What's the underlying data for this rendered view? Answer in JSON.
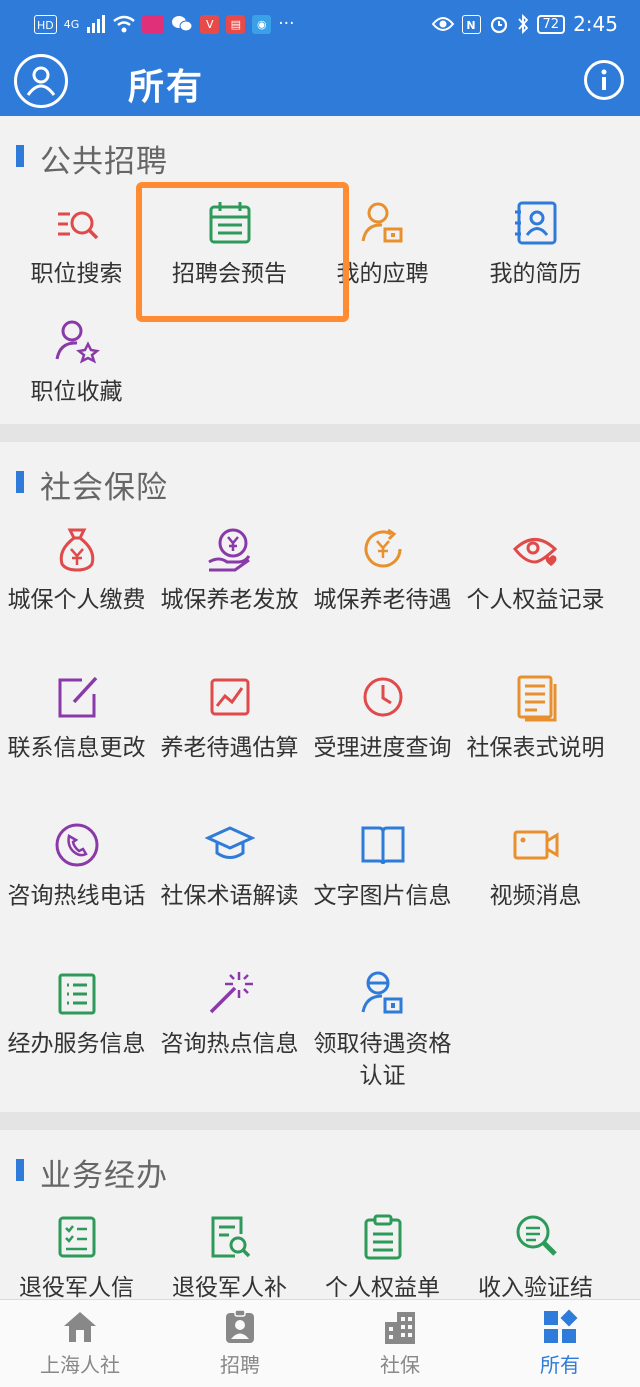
{
  "status_bar": {
    "net": "HD",
    "signal": "4G",
    "battery": "72",
    "time": "2:45"
  },
  "header": {
    "title": "所有"
  },
  "sections": [
    {
      "title": "公共招聘",
      "items": [
        {
          "label": "职位搜索",
          "icon": "job-search-icon",
          "color": "#e04a4a"
        },
        {
          "label": "招聘会预告",
          "icon": "calendar-icon",
          "color": "#2e9a5a"
        },
        {
          "label": "我的应聘",
          "icon": "person-apply-icon",
          "color": "#e8902e"
        },
        {
          "label": "我的简历",
          "icon": "resume-icon",
          "color": "#2f7bd9"
        },
        {
          "label": "职位收藏",
          "icon": "person-star-icon",
          "color": "#8a3aa8"
        }
      ]
    },
    {
      "title": "社会保险",
      "items": [
        {
          "label": "城保个人缴费",
          "icon": "money-bag-icon",
          "color": "#e04a4a"
        },
        {
          "label": "城保养老发放",
          "icon": "hand-coin-icon",
          "color": "#8a3aa8"
        },
        {
          "label": "城保养老待遇",
          "icon": "coin-cycle-icon",
          "color": "#e8902e"
        },
        {
          "label": "个人权益记录",
          "icon": "eye-heart-icon",
          "color": "#e04a4a"
        },
        {
          "label": "联系信息更改",
          "icon": "edit-square-icon",
          "color": "#8a3aa8"
        },
        {
          "label": "养老待遇估算",
          "icon": "chart-icon",
          "color": "#e04a4a"
        },
        {
          "label": "受理进度查询",
          "icon": "clock-icon",
          "color": "#e04a4a"
        },
        {
          "label": "社保表式说明",
          "icon": "document-icon",
          "color": "#e8902e"
        },
        {
          "label": "咨询热线电话",
          "icon": "phone-icon",
          "color": "#8a3aa8"
        },
        {
          "label": "社保术语解读",
          "icon": "graduation-cap-icon",
          "color": "#2f7bd9"
        },
        {
          "label": "文字图片信息",
          "icon": "book-icon",
          "color": "#2f7bd9"
        },
        {
          "label": "视频消息",
          "icon": "video-icon",
          "color": "#e8902e"
        },
        {
          "label": "经办服务信息",
          "icon": "list-icon",
          "color": "#2e9a5a"
        },
        {
          "label": "咨询热点信息",
          "icon": "magic-wand-icon",
          "color": "#8a3aa8"
        },
        {
          "label": "领取待遇资格认证",
          "icon": "person-id-icon",
          "color": "#2f7bd9"
        }
      ]
    },
    {
      "title": "业务经办",
      "items": [
        {
          "label": "退役军人信",
          "icon": "checklist-icon",
          "color": "#2e9a5a"
        },
        {
          "label": "退役军人补",
          "icon": "doc-search-icon",
          "color": "#2e9a5a"
        },
        {
          "label": "个人权益单",
          "icon": "clipboard-icon",
          "color": "#2e9a5a"
        },
        {
          "label": "收入验证结",
          "icon": "magnifier-icon",
          "color": "#2e9a5a"
        }
      ]
    }
  ],
  "tabs": [
    {
      "label": "上海人社",
      "icon": "home-icon",
      "active": false
    },
    {
      "label": "招聘",
      "icon": "badge-icon",
      "active": false
    },
    {
      "label": "社保",
      "icon": "building-icon",
      "active": false
    },
    {
      "label": "所有",
      "icon": "apps-icon",
      "active": true
    }
  ],
  "colors": {
    "brand": "#2f7bd9",
    "highlight": "#ff8c33",
    "tab_inactive": "#888888"
  }
}
